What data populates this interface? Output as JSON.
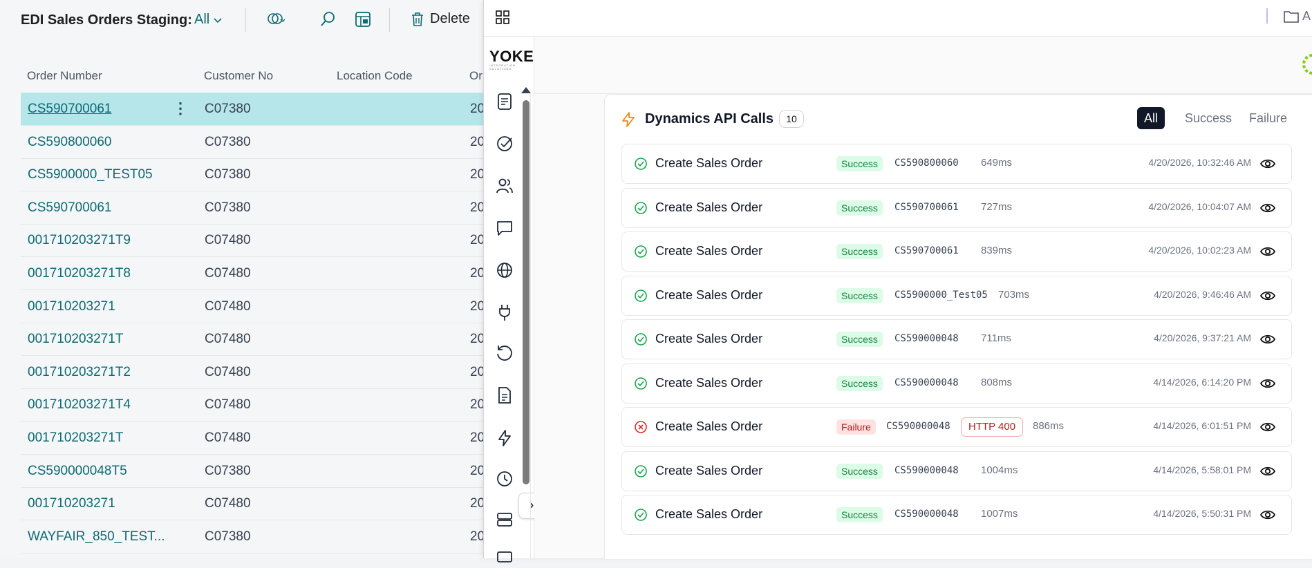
{
  "bc": {
    "title": "EDI Sales Orders Staging:",
    "filter": "All",
    "delete_label": "Delete",
    "columns": [
      "Order Number",
      "Customer No",
      "Location Code",
      "Or"
    ],
    "rows": [
      {
        "order": "CS590700061",
        "customer": "C07380",
        "col4": "20"
      },
      {
        "order": "CS590800060",
        "customer": "C07380",
        "col4": "20"
      },
      {
        "order": "CS5900000_TEST05",
        "customer": "C07380",
        "col4": "20"
      },
      {
        "order": "CS590700061",
        "customer": "C07380",
        "col4": "20"
      },
      {
        "order": "001710203271T9",
        "customer": "C07480",
        "col4": "20"
      },
      {
        "order": "001710203271T8",
        "customer": "C07480",
        "col4": "20"
      },
      {
        "order": "001710203271",
        "customer": "C07480",
        "col4": "20"
      },
      {
        "order": "001710203271T",
        "customer": "C07480",
        "col4": "20"
      },
      {
        "order": "001710203271T2",
        "customer": "C07480",
        "col4": "20"
      },
      {
        "order": "001710203271T4",
        "customer": "C07480",
        "col4": "20"
      },
      {
        "order": "001710203271T",
        "customer": "C07480",
        "col4": "20"
      },
      {
        "order": "CS590000048T5",
        "customer": "C07380",
        "col4": "20"
      },
      {
        "order": "001710203271",
        "customer": "C07480",
        "col4": "20"
      },
      {
        "order": "WAYFAIR_850_TEST...",
        "customer": "C07380",
        "col4": "20"
      }
    ]
  },
  "panel": {
    "logo": "YOKE",
    "logo_sub": "INTEGRATION SOLUTIONS",
    "top_right_text": "A",
    "nav_icons": [
      "document-list-icon",
      "check-circle-icon",
      "users-icon",
      "message-icon",
      "globe-icon",
      "plug-icon",
      "history-icon",
      "file-text-icon",
      "zap-icon",
      "clock-icon",
      "server-icon",
      "monitor-icon"
    ],
    "title": "Dynamics API Calls",
    "count": "10",
    "filters": [
      "All",
      "Success",
      "Failure"
    ],
    "active_filter": "All",
    "calls": [
      {
        "name": "Create Sales Order",
        "status": "Success",
        "order": "CS590800060",
        "http": "",
        "ms": "649ms",
        "time": "4/20/2026, 10:32:46 AM"
      },
      {
        "name": "Create Sales Order",
        "status": "Success",
        "order": "CS590700061",
        "http": "",
        "ms": "727ms",
        "time": "4/20/2026, 10:04:07 AM"
      },
      {
        "name": "Create Sales Order",
        "status": "Success",
        "order": "CS590700061",
        "http": "",
        "ms": "839ms",
        "time": "4/20/2026, 10:02:23 AM"
      },
      {
        "name": "Create Sales Order",
        "status": "Success",
        "order": "CS5900000_Test05",
        "http": "",
        "ms": "703ms",
        "time": "4/20/2026, 9:46:46 AM"
      },
      {
        "name": "Create Sales Order",
        "status": "Success",
        "order": "CS590000048",
        "http": "",
        "ms": "711ms",
        "time": "4/20/2026, 9:37:21 AM"
      },
      {
        "name": "Create Sales Order",
        "status": "Success",
        "order": "CS590000048",
        "http": "",
        "ms": "808ms",
        "time": "4/14/2026, 6:14:20 PM"
      },
      {
        "name": "Create Sales Order",
        "status": "Failure",
        "order": "CS590000048",
        "http": "HTTP 400",
        "ms": "886ms",
        "time": "4/14/2026, 6:01:51 PM"
      },
      {
        "name": "Create Sales Order",
        "status": "Success",
        "order": "CS590000048",
        "http": "",
        "ms": "1004ms",
        "time": "4/14/2026, 5:58:01 PM"
      },
      {
        "name": "Create Sales Order",
        "status": "Success",
        "order": "CS590000048",
        "http": "",
        "ms": "1007ms",
        "time": "4/14/2026, 5:50:31 PM"
      }
    ]
  },
  "colors": {
    "accent": "#0b6a73",
    "success": "#15803d",
    "failure": "#b91c1c",
    "bolt": "#ea8a1a"
  }
}
